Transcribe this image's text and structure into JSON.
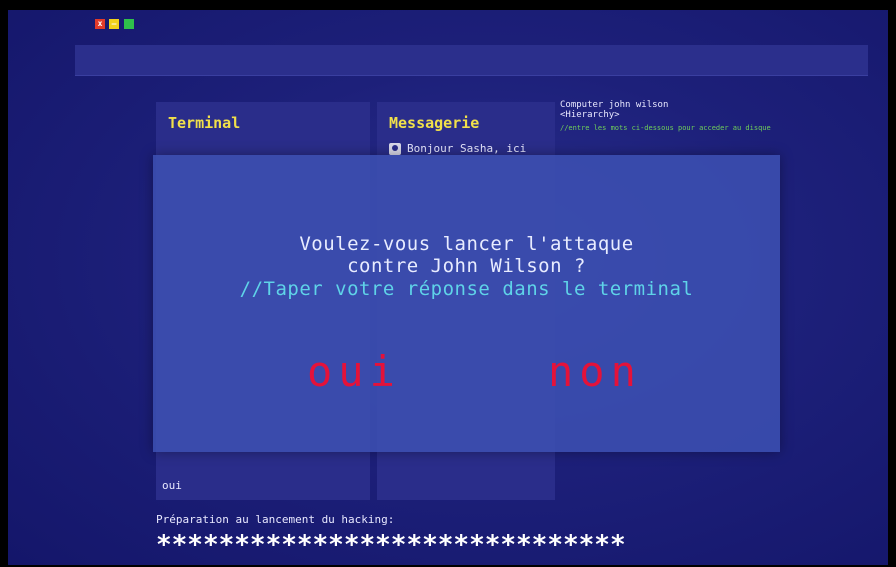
{
  "window": {
    "close_label": "x",
    "minimize_label": "—",
    "maximize_label": ""
  },
  "terminal": {
    "title": "Terminal",
    "input_value": "oui"
  },
  "messagerie": {
    "title": "Messagerie",
    "items": [
      {
        "icon": "user-avatar-icon",
        "text": "Bonjour Sasha, ici"
      }
    ]
  },
  "computer_panel": {
    "line1": "Computer john wilson",
    "line2": "<Hierarchy>",
    "hint": "//entre les mots ci-dessous pour acceder au disque"
  },
  "dialog": {
    "question": "Voulez-vous lancer l'attaque contre John Wilson ?",
    "instruction": "//Taper votre réponse dans le terminal",
    "yes_label": "oui",
    "no_label": "non"
  },
  "status": {
    "label": "Préparation au lancement du hacking:",
    "progress_text": "******************************"
  },
  "colors": {
    "background": "#1d207a",
    "panel": "#2a2d8a",
    "title_yellow": "#f1e04a",
    "choice_red": "#e4123a",
    "instruction_cyan": "#5fd3e8",
    "hint_green": "#6fd05a"
  }
}
